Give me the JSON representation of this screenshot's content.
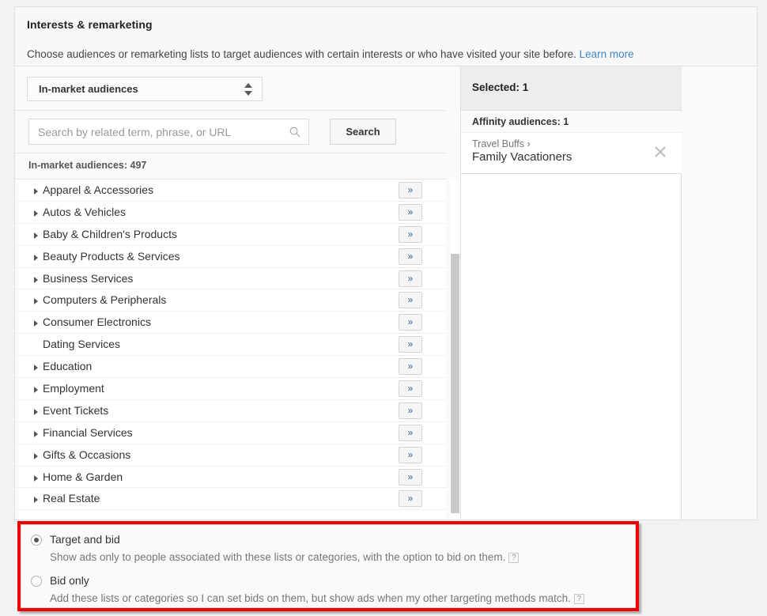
{
  "panel": {
    "title": "Interests & remarketing",
    "description": "Choose audiences or remarketing lists to target audiences with certain interests or who have visited your site before.",
    "learn_more": "Learn more"
  },
  "picker": {
    "type_select": {
      "value": "In-market audiences",
      "icon": "updown-chevron-icon"
    },
    "search": {
      "placeholder": "Search by related term, phrase, or URL",
      "value": "",
      "icon": "search-icon",
      "button_label": "Search"
    },
    "list_count_label": "In-market audiences: 497",
    "expand_button_label": "»",
    "categories": [
      {
        "label": "Apparel & Accessories",
        "expandable": true
      },
      {
        "label": "Autos & Vehicles",
        "expandable": true
      },
      {
        "label": "Baby & Children's Products",
        "expandable": true
      },
      {
        "label": "Beauty Products & Services",
        "expandable": true
      },
      {
        "label": "Business Services",
        "expandable": true
      },
      {
        "label": "Computers & Peripherals",
        "expandable": true
      },
      {
        "label": "Consumer Electronics",
        "expandable": true
      },
      {
        "label": "Dating Services",
        "expandable": false
      },
      {
        "label": "Education",
        "expandable": true
      },
      {
        "label": "Employment",
        "expandable": true
      },
      {
        "label": "Event Tickets",
        "expandable": true
      },
      {
        "label": "Financial Services",
        "expandable": true
      },
      {
        "label": "Gifts & Occasions",
        "expandable": true
      },
      {
        "label": "Home & Garden",
        "expandable": true
      },
      {
        "label": "Real Estate",
        "expandable": true
      }
    ]
  },
  "selection": {
    "header": "Selected: 1",
    "group_header": "Affinity audiences: 1",
    "items": [
      {
        "parent": "Travel Buffs ›",
        "name": "Family Vacationers",
        "remove_icon": "close-icon"
      }
    ]
  },
  "bid_options": {
    "highlight_color": "#ef0000",
    "options": [
      {
        "label": "Target and bid",
        "description": "Show ads only to people associated with these lists or categories, with the option to bid on them.",
        "help_icon": "?",
        "selected": true
      },
      {
        "label": "Bid only",
        "description": "Add these lists or categories so I can set bids on them, but show ads when my other targeting methods match.",
        "help_icon": "?",
        "selected": false
      }
    ]
  }
}
